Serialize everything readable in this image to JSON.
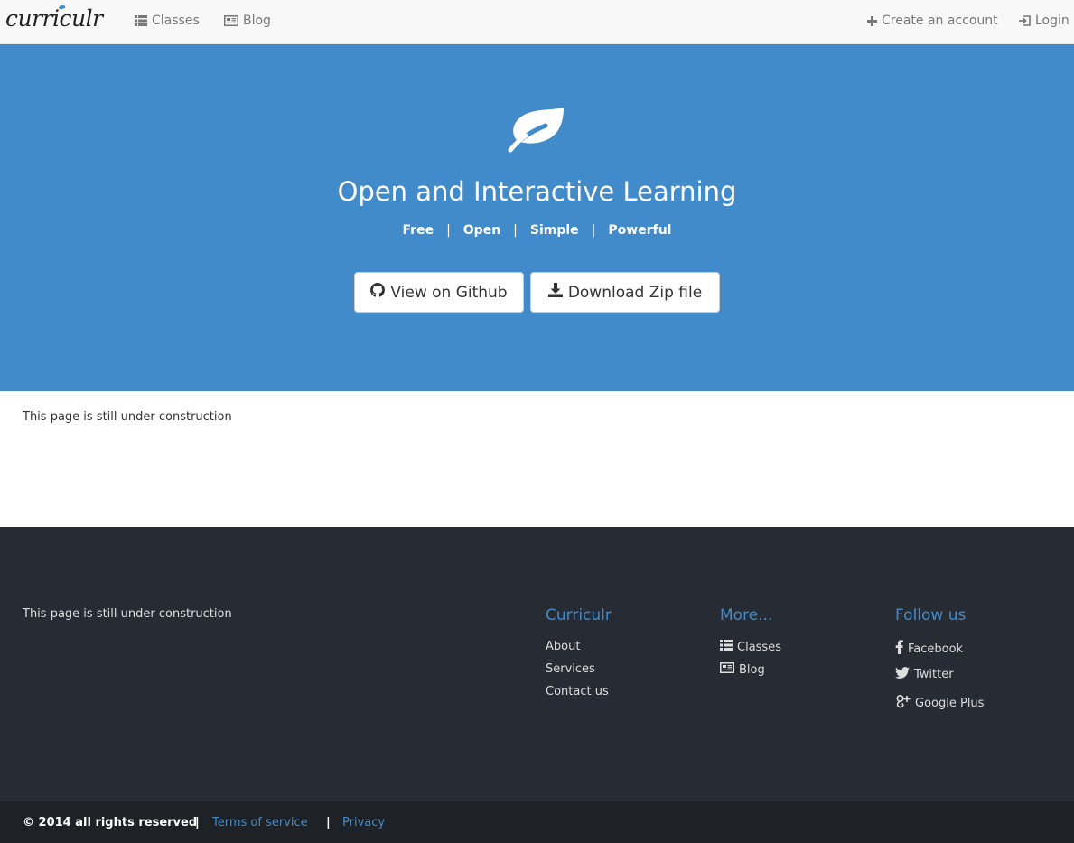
{
  "navbar": {
    "brand": "curriculr",
    "links": [
      {
        "label": "Classes",
        "icon": "list-icon"
      },
      {
        "label": "Blog",
        "icon": "newspaper-icon"
      }
    ],
    "right_links": [
      {
        "label": "Create an account",
        "icon": "plus-icon"
      },
      {
        "label": "Login",
        "icon": "login-icon"
      }
    ]
  },
  "hero": {
    "icon": "leaf-icon",
    "title": "Open and Interactive Learning",
    "tagline": [
      "Free",
      "Open",
      "Simple",
      "Powerful"
    ],
    "tagline_separator": "|",
    "buttons": [
      {
        "label": "View on Github",
        "icon": "github-icon"
      },
      {
        "label": "Download Zip file",
        "icon": "download-icon"
      }
    ]
  },
  "content": {
    "text": "This page is still under construction"
  },
  "footer": {
    "text": "This page is still under construction",
    "columns": [
      {
        "title": "Curriculr",
        "links": [
          "About",
          "Services",
          "Contact us"
        ]
      },
      {
        "title": "More...",
        "links": [
          {
            "label": "Classes",
            "icon": "list-icon"
          },
          {
            "label": "Blog",
            "icon": "newspaper-icon"
          }
        ]
      },
      {
        "title": "Follow us",
        "links": [
          {
            "label": "Facebook",
            "icon": "facebook-icon"
          },
          {
            "label": "Twitter",
            "icon": "twitter-icon"
          },
          {
            "label": "Google Plus",
            "icon": "google-plus-icon"
          }
        ]
      }
    ]
  },
  "bottom": {
    "copyright": "© 2014 all rights reserved",
    "separator": "|",
    "links": [
      "Terms of service",
      "Privacy"
    ]
  },
  "colors": {
    "hero_bg": "#428bca",
    "footer_bg": "#262b34",
    "bottom_bg": "#1e2226",
    "accent": "#428bca"
  }
}
